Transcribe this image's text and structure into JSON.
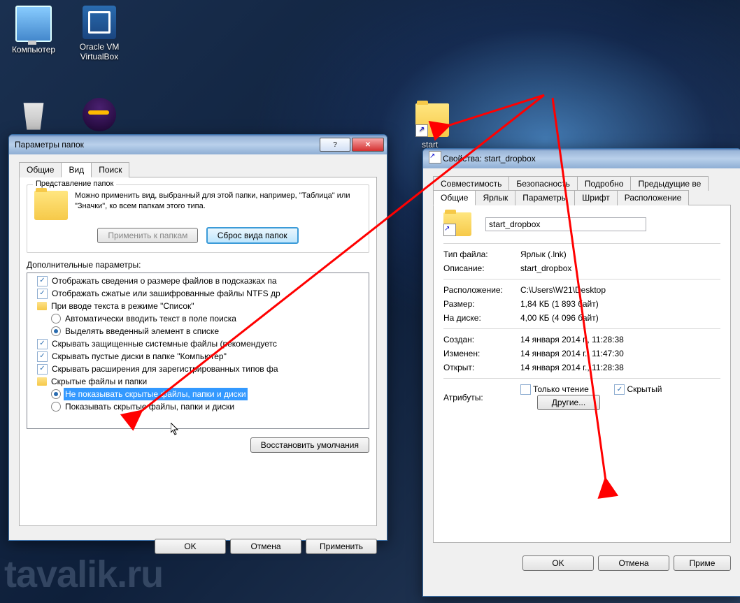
{
  "desktop": {
    "icons": [
      {
        "name": "computer",
        "label": "Компьютер"
      },
      {
        "name": "virtualbox",
        "label": "Oracle VM VirtualBox"
      },
      {
        "name": "recyclebin",
        "label": ""
      },
      {
        "name": "eclipse",
        "label": ""
      },
      {
        "name": "start-dropbox",
        "label": "start_"
      }
    ]
  },
  "folderOptions": {
    "title": "Параметры папок",
    "tabs": {
      "general": "Общие",
      "view": "Вид",
      "search": "Поиск"
    },
    "group1": {
      "legend": "Представление папок",
      "desc": "Можно применить вид, выбранный для этой папки, например, \"Таблица\" или \"Значки\", ко всем папкам этого типа.",
      "applyBtn": "Применить к папкам",
      "resetBtn": "Сброс вида папок"
    },
    "advLabel": "Дополнительные параметры:",
    "tree": [
      {
        "t": "check",
        "on": true,
        "ind": 0,
        "txt": "Отображать сведения о размере файлов в подсказках па"
      },
      {
        "t": "check",
        "on": true,
        "ind": 0,
        "txt": "Отображать сжатые или зашифрованные файлы NTFS др"
      },
      {
        "t": "folder",
        "ind": 0,
        "txt": "При вводе текста в режиме \"Список\""
      },
      {
        "t": "radio",
        "on": false,
        "ind": 1,
        "txt": "Автоматически вводить текст в поле поиска"
      },
      {
        "t": "radio",
        "on": true,
        "ind": 1,
        "txt": "Выделять введенный элемент в списке"
      },
      {
        "t": "check",
        "on": true,
        "ind": 0,
        "txt": "Скрывать защищенные системные файлы (рекомендуетс"
      },
      {
        "t": "check",
        "on": true,
        "ind": 0,
        "txt": "Скрывать пустые диски в папке \"Компьютер\""
      },
      {
        "t": "check",
        "on": true,
        "ind": 0,
        "txt": "Скрывать расширения для зарегистрированных типов фа"
      },
      {
        "t": "folder",
        "ind": 0,
        "txt": "Скрытые файлы и папки"
      },
      {
        "t": "radio",
        "on": true,
        "ind": 1,
        "sel": true,
        "txt": "Не показывать скрытые файлы, папки и диски"
      },
      {
        "t": "radio",
        "on": false,
        "ind": 1,
        "txt": "Показывать скрытые файлы, папки и диски"
      }
    ],
    "restoreBtn": "Восстановить умолчания",
    "ok": "OK",
    "cancel": "Отмена",
    "apply": "Применить"
  },
  "properties": {
    "title": "Свойства: start_dropbox",
    "tabs": {
      "row1": [
        "Совместимость",
        "Безопасность",
        "Подробно",
        "Предыдущие ве"
      ],
      "row2": [
        "Общие",
        "Ярлык",
        "Параметры",
        "Шрифт",
        "Расположение"
      ]
    },
    "name": "start_dropbox",
    "fields": {
      "fileType": {
        "k": "Тип файла:",
        "v": "Ярлык (.lnk)"
      },
      "desc": {
        "k": "Описание:",
        "v": "start_dropbox"
      },
      "location": {
        "k": "Расположение:",
        "v": "C:\\Users\\W21\\Desktop"
      },
      "size": {
        "k": "Размер:",
        "v": "1,84 КБ (1 893 байт)"
      },
      "onDisk": {
        "k": "На диске:",
        "v": "4,00 КБ (4 096 байт)"
      },
      "created": {
        "k": "Создан:",
        "v": "14 января 2014 г., 11:28:38"
      },
      "modified": {
        "k": "Изменен:",
        "v": "14 января 2014 г., 11:47:30"
      },
      "opened": {
        "k": "Открыт:",
        "v": "14 января 2014 г., 11:28:38"
      }
    },
    "attrs": {
      "label": "Атрибуты:",
      "readonly": "Только чтение",
      "hidden": "Скрытый",
      "other": "Другие..."
    },
    "ok": "OK",
    "cancel": "Отмена",
    "apply": "Приме"
  },
  "watermark": "tavalik.ru"
}
